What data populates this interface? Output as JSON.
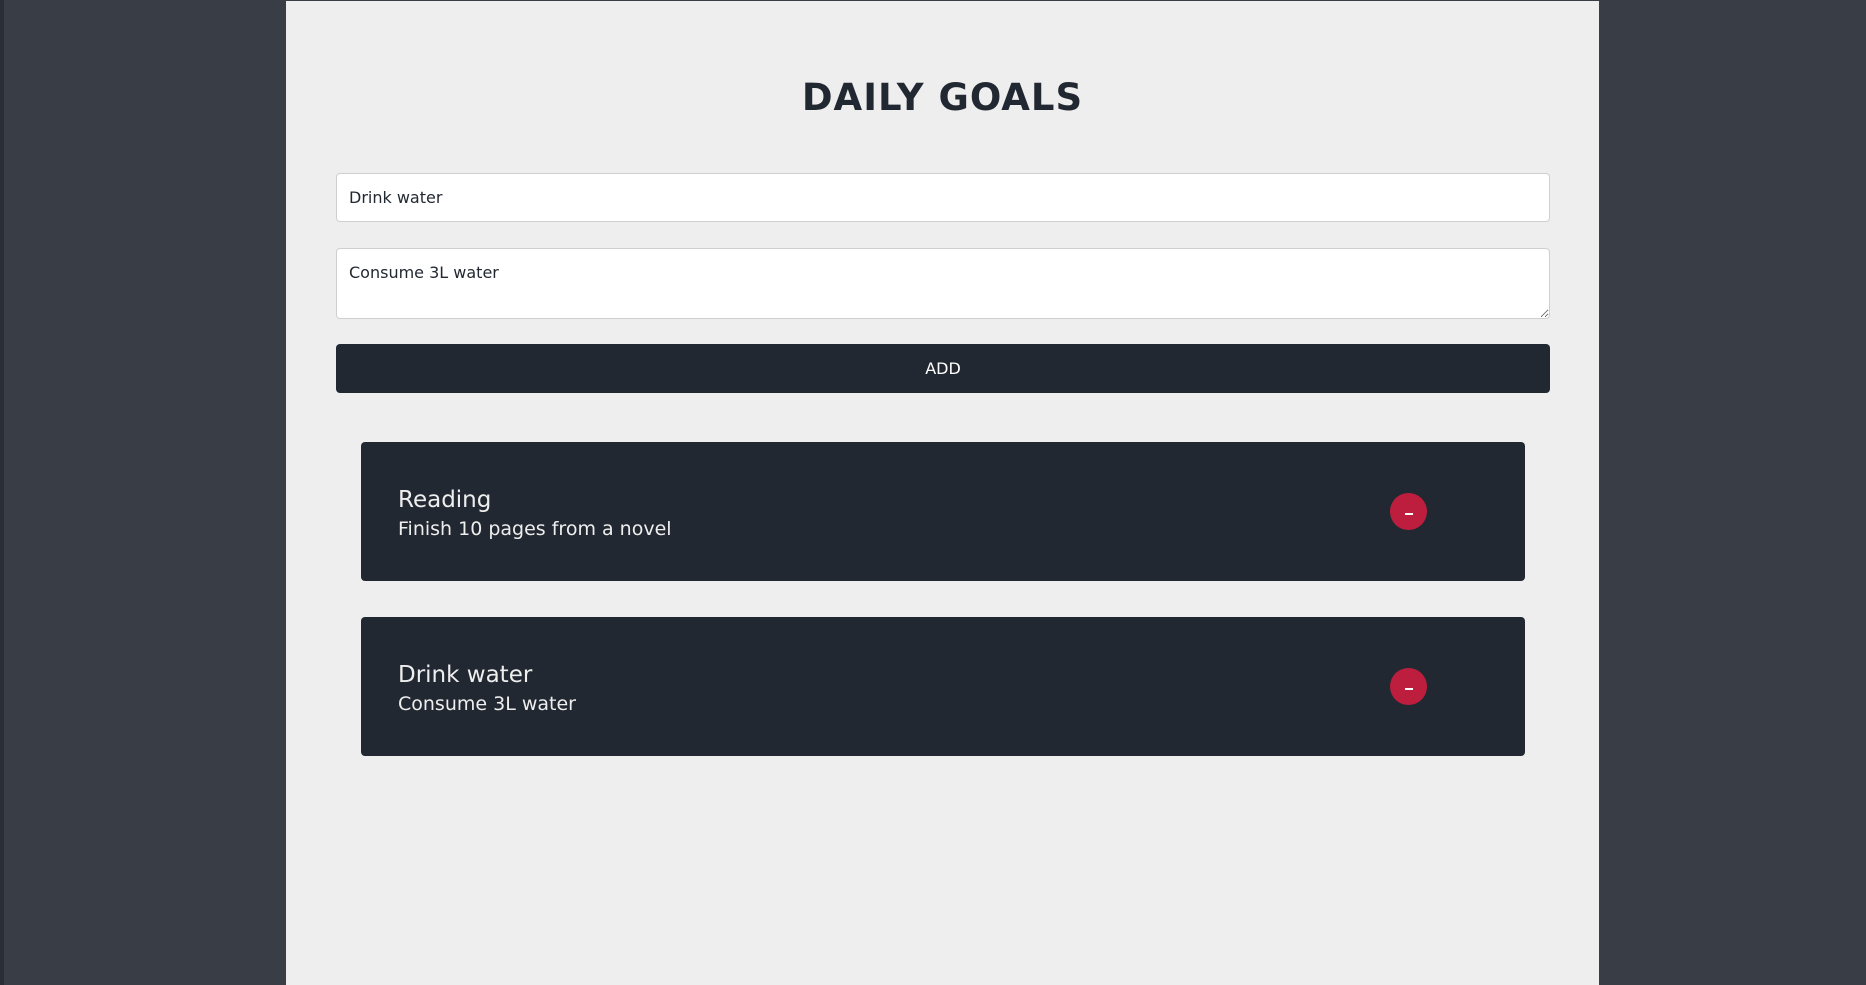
{
  "page": {
    "title": "DAILY GOALS"
  },
  "form": {
    "title_value": "Drink water",
    "description_value": "Consume 3L water",
    "add_label": "ADD"
  },
  "goals": [
    {
      "title": "Reading",
      "description": "Finish 10 pages from a novel",
      "delete_icon": "minus-icon"
    },
    {
      "title": "Drink water",
      "description": "Consume 3L water",
      "delete_icon": "minus-icon"
    }
  ],
  "colors": {
    "background": "#393e46",
    "panel": "#eeeeee",
    "card": "#222831",
    "accent_delete": "#be1e3e",
    "text_dark": "#222831",
    "text_light": "#eeeeee"
  }
}
